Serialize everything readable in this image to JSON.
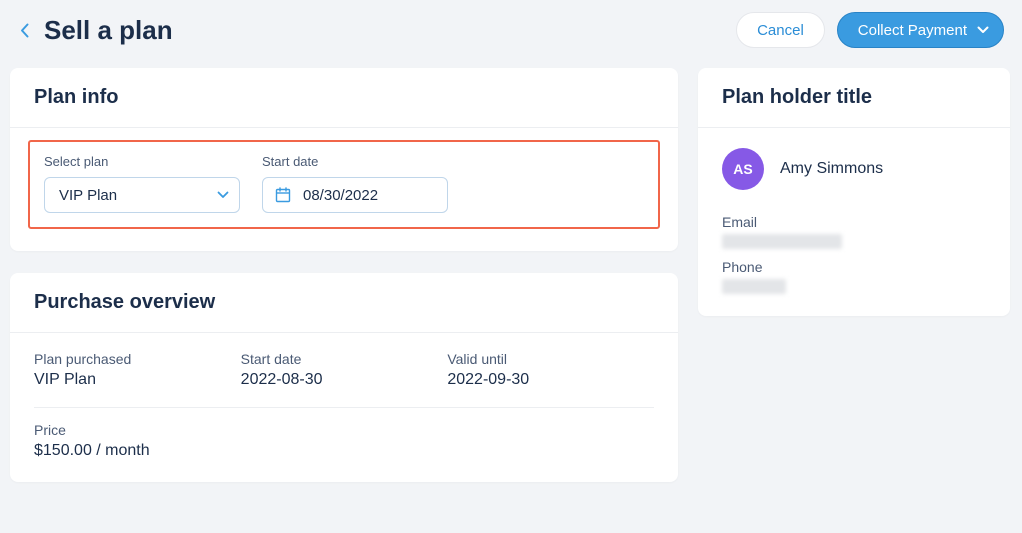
{
  "header": {
    "title": "Sell a plan",
    "cancel_label": "Cancel",
    "collect_payment_label": "Collect Payment"
  },
  "plan_info": {
    "card_title": "Plan info",
    "select_plan_label": "Select plan",
    "selected_plan": "VIP Plan",
    "start_date_label": "Start date",
    "start_date_value": "08/30/2022"
  },
  "purchase_overview": {
    "card_title": "Purchase overview",
    "plan_purchased_label": "Plan purchased",
    "plan_purchased_value": "VIP Plan",
    "start_date_label": "Start date",
    "start_date_value": "2022-08-30",
    "valid_until_label": "Valid until",
    "valid_until_value": "2022-09-30",
    "price_label": "Price",
    "price_value": "$150.00 / month"
  },
  "plan_holder": {
    "card_title": "Plan holder title",
    "avatar_initials": "AS",
    "name": "Amy Simmons",
    "email_label": "Email",
    "phone_label": "Phone"
  }
}
